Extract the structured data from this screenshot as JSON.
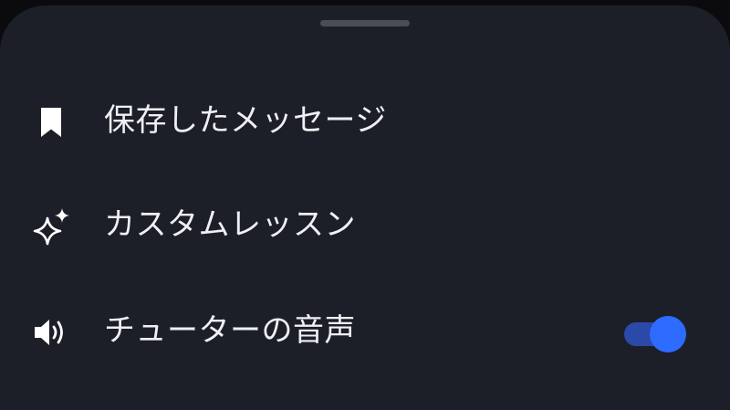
{
  "menu": {
    "items": [
      {
        "label": "保存したメッセージ",
        "icon": "bookmark-icon"
      },
      {
        "label": "カスタムレッスン",
        "icon": "sparkles-icon"
      },
      {
        "label": "チューターの音声",
        "icon": "speaker-icon",
        "toggle_on": true
      }
    ]
  },
  "colors": {
    "background": "#1c1f28",
    "text": "#eef0f4",
    "toggle_track": "#2b49a8",
    "toggle_knob": "#2e6bff",
    "handle": "#4a4d58"
  }
}
